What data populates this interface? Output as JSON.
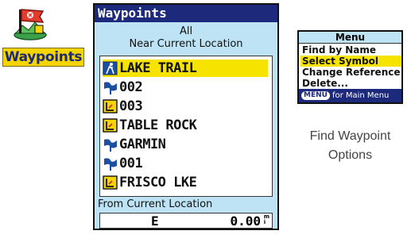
{
  "app": {
    "icon_name": "waypoints-flag-icon",
    "label": "Waypoints"
  },
  "screen": {
    "title": "Waypoints",
    "filter_line1": "All",
    "filter_line2": "Near Current Location",
    "waypoints": [
      {
        "name": "LAKE TRAIL",
        "icon": "trail-head-icon",
        "selected": true
      },
      {
        "name": "002",
        "icon": "blue-flag-icon",
        "selected": false
      },
      {
        "name": "003",
        "icon": "yellow-waypoint-icon",
        "selected": false
      },
      {
        "name": "TABLE ROCK",
        "icon": "yellow-waypoint-icon",
        "selected": false
      },
      {
        "name": "GARMIN",
        "icon": "blue-flag-icon",
        "selected": false
      },
      {
        "name": "001",
        "icon": "blue-flag-icon",
        "selected": false
      },
      {
        "name": "FRISCO LKE",
        "icon": "yellow-waypoint-icon",
        "selected": false
      }
    ],
    "footer_label": "From Current Location",
    "direction": "E",
    "distance": "0.00",
    "distance_unit": "m",
    "distance_unit_sub": "i"
  },
  "menu": {
    "title": "Menu",
    "items": [
      {
        "label": "Find by Name",
        "selected": false
      },
      {
        "label": "Select Symbol",
        "selected": true
      },
      {
        "label": "Change Reference",
        "selected": false
      },
      {
        "label": "Delete...",
        "selected": false
      }
    ],
    "footer_key": "MENU",
    "footer_text": "for Main Menu"
  },
  "caption": {
    "line1": "Find Waypoint",
    "line2": "Options"
  },
  "colors": {
    "screen_bg": "#bde3f5",
    "title_bar": "#1d2a7c",
    "highlight": "#f7e300",
    "label_bg": "#f5d400"
  }
}
